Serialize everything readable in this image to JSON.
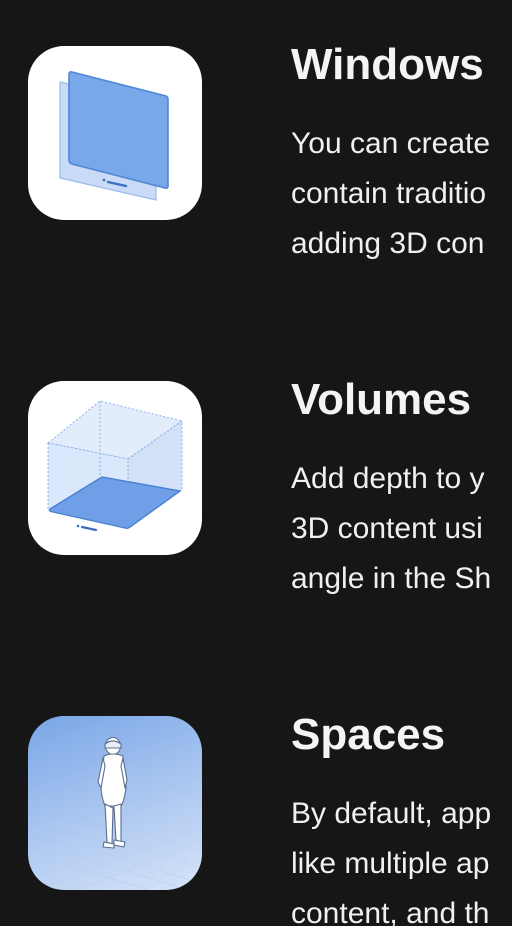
{
  "sections": [
    {
      "title": "Windows",
      "icon": "window-icon",
      "lines": [
        "You can create",
        "contain traditio",
        "adding 3D con"
      ]
    },
    {
      "title": "Volumes",
      "icon": "volume-icon",
      "lines": [
        "Add depth to y",
        "3D content usi",
        "angle in the Sh"
      ]
    },
    {
      "title": "Spaces",
      "icon": "spaces-icon",
      "lines": [
        "By default, app",
        "like multiple ap",
        "content, and th"
      ]
    }
  ],
  "colors": {
    "background": "#161616",
    "accent_blue": "#78a8ea",
    "text": "#f2f2f2"
  }
}
